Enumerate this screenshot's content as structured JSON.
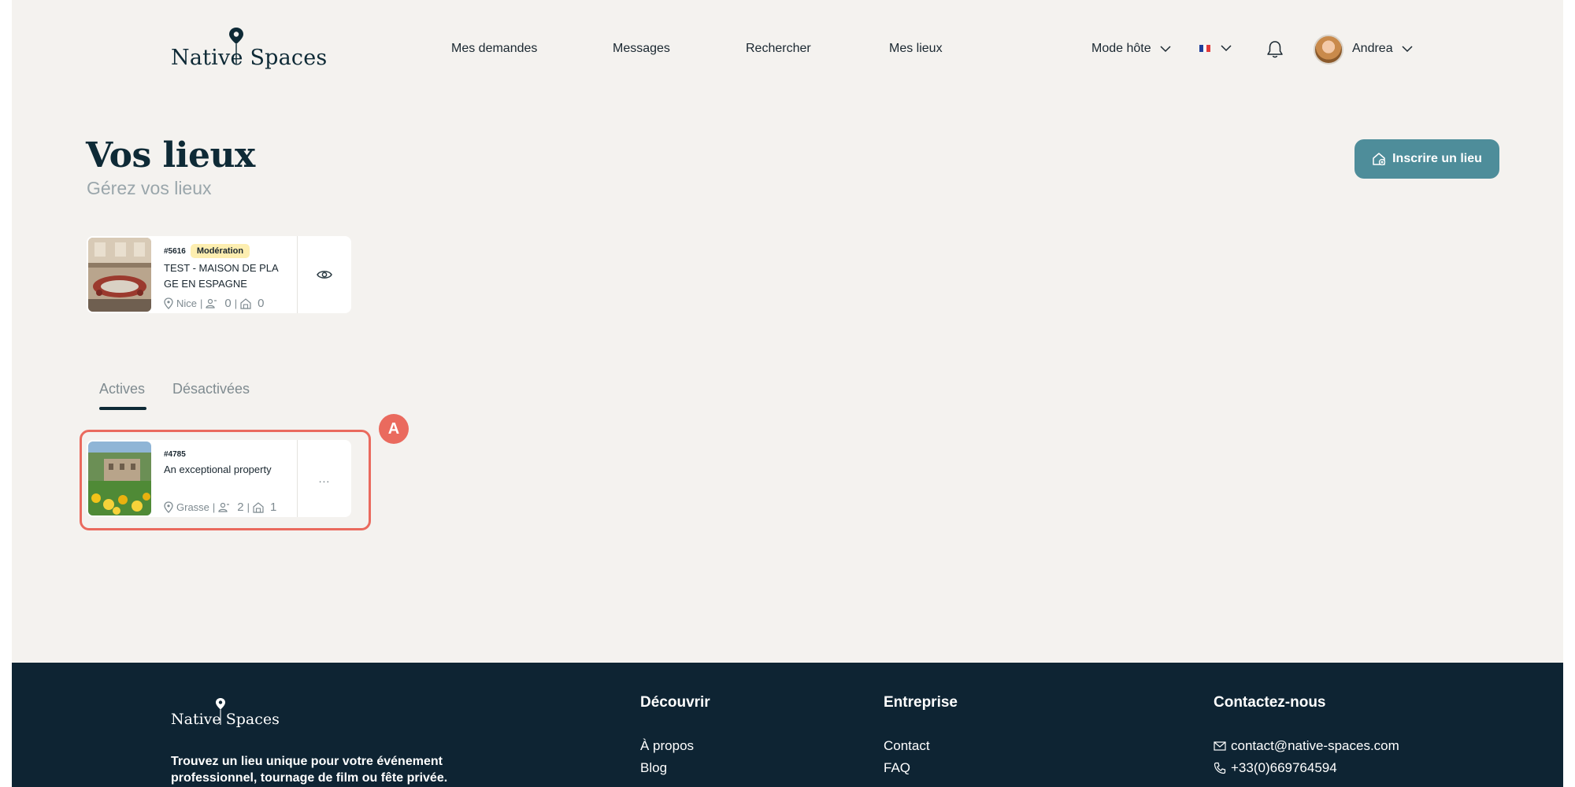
{
  "header": {
    "logo_word1": "Native",
    "logo_word2": "Spaces",
    "nav": [
      "Mes demandes",
      "Messages",
      "Rechercher",
      "Mes lieux"
    ],
    "mode_label": "Mode hôte",
    "user_name": "Andrea",
    "language": "fr"
  },
  "page": {
    "title": "Vos lieux",
    "subtitle": "Gérez vos lieux",
    "add_button_label": "Inscrire un lieu"
  },
  "pending_listing": {
    "ref": "#5616",
    "status": "Modération",
    "title": "TEST - MAISON DE PLAGE EN ESPAGNE",
    "city": "Nice",
    "capacity": "0",
    "rooms": "0",
    "action_icon": "eye-icon"
  },
  "tabs": {
    "active": "Actives",
    "inactive": "Désactivées"
  },
  "active_listings": [
    {
      "ref": "#4785",
      "title": "An exceptional property",
      "city": "Grasse",
      "capacity": "2",
      "rooms": "1",
      "action_label": "..."
    }
  ],
  "annotation": {
    "marker": "A"
  },
  "footer": {
    "logo_word1": "Native",
    "logo_word2": "Spaces",
    "tagline": "Trouvez un lieu unique pour votre événement professionnel, tournage de film ou fête privée.",
    "discover_heading": "Découvrir",
    "discover_links": [
      "À propos",
      "Blog"
    ],
    "company_heading": "Entreprise",
    "company_links": [
      "Contact",
      "FAQ"
    ],
    "contact_heading": "Contactez-nous",
    "email": "contact@native-spaces.com",
    "phone": "+33(0)669764594"
  },
  "colors": {
    "background": "#f4f2ef",
    "brand_dark": "#0e2a36",
    "accent": "#4e8d9a",
    "badge": "#fdeeb0",
    "annotation": "#ea6a5e",
    "footer": "#0e2433"
  }
}
